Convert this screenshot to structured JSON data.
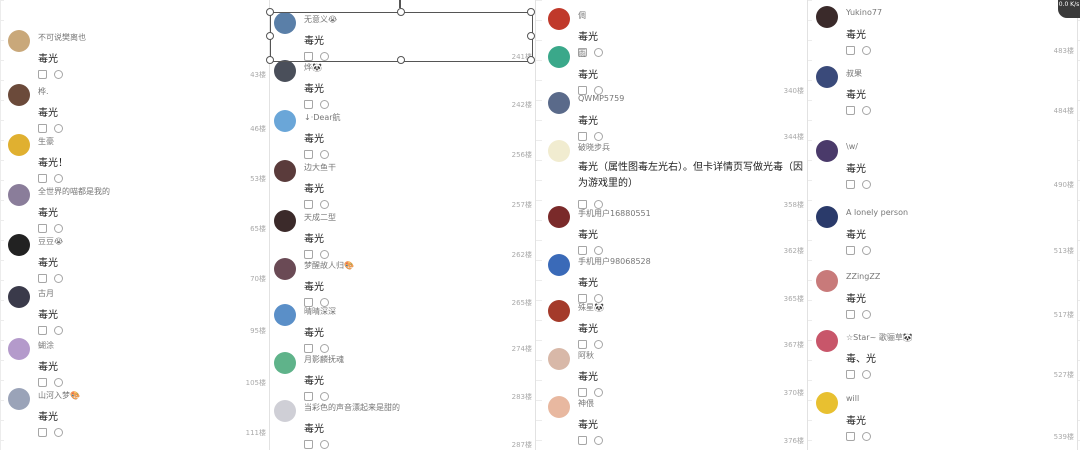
{
  "columns": [
    {
      "comments": [
        {
          "user": "不可说樊离也",
          "text": "毒光",
          "floor": "43楼",
          "avatar_color": "#c9a87a"
        },
        {
          "user": "桦.",
          "text": "毒光",
          "floor": "46楼",
          "avatar_color": "#6b4a3a"
        },
        {
          "user": "生豪",
          "text": "毒光！",
          "floor": "53楼",
          "avatar_color": "#e0b030"
        },
        {
          "user": "全世界的喵都是我的",
          "text": "毒光",
          "floor": "65楼",
          "avatar_color": "#8a7d9a"
        },
        {
          "user": "豆豆😭",
          "text": "毒光",
          "floor": "70楼",
          "avatar_color": "#222222"
        },
        {
          "user": "古月",
          "text": "毒光",
          "floor": "95楼",
          "avatar_color": "#3a3a4a"
        },
        {
          "user": "蝴涂",
          "text": "毒光",
          "floor": "105楼",
          "avatar_color": "#b49acb"
        },
        {
          "user": "山河入梦🎨",
          "text": "毒光",
          "floor": "111楼",
          "avatar_color": "#9aa3b8"
        }
      ]
    },
    {
      "comments": [
        {
          "user": "无意义😭",
          "text": "毒光",
          "floor": "241楼",
          "avatar_color": "#5a7fa8"
        },
        {
          "user": "烨🐼",
          "text": "毒光",
          "floor": "242楼",
          "avatar_color": "#4a4f5a"
        },
        {
          "user": "↓·Dear航",
          "text": "毒光",
          "floor": "256楼",
          "avatar_color": "#6aa6d8"
        },
        {
          "user": "边大鱼干",
          "text": "毒光",
          "floor": "257楼",
          "avatar_color": "#5a3b3b"
        },
        {
          "user": "天成二型",
          "text": "毒光",
          "floor": "262楼",
          "avatar_color": "#3b2a2a"
        },
        {
          "user": "梦醒故人归🎨",
          "text": "毒光",
          "floor": "265楼",
          "avatar_color": "#6a4a55"
        },
        {
          "user": "晴晴深深",
          "text": "毒光",
          "floor": "274楼",
          "avatar_color": "#5a8fc8"
        },
        {
          "user": "月影麟抚魂",
          "text": "毒光",
          "floor": "283楼",
          "avatar_color": "#5fb38a"
        },
        {
          "user": "当彩色的声音漂起来是甜的",
          "text": "毒光",
          "floor": "287楼",
          "avatar_color": "#cfcfd6"
        }
      ]
    },
    {
      "comments": [
        {
          "user": "倜",
          "text": "毒光",
          "floor": "",
          "avatar_color": "#c0392b"
        },
        {
          "user": "雨",
          "text": "毒光",
          "floor": "340楼",
          "avatar_color": "#3aa88a"
        },
        {
          "user": "QWMP5759",
          "text": "毒光",
          "floor": "344楼",
          "avatar_color": "#5a6a8a"
        },
        {
          "user": "破晓步兵",
          "text": "毒光（属性图毒左光右）。但卡详情页写做光毒（因为游戏里的）",
          "floor": "358楼",
          "avatar_color": "#f1ecd0"
        },
        {
          "user": "手机用户16880551",
          "text": "毒光",
          "floor": "362楼",
          "avatar_color": "#7a2a2a"
        },
        {
          "user": "手机用户98068528",
          "text": "毒光",
          "floor": "365楼",
          "avatar_color": "#3a6ab8"
        },
        {
          "user": "殊星🐼",
          "text": "毒光",
          "floor": "367楼",
          "avatar_color": "#a43a2a"
        },
        {
          "user": "阿秋",
          "text": "毒光",
          "floor": "370楼",
          "avatar_color": "#d8b8a8"
        },
        {
          "user": "神偎",
          "text": "毒光",
          "floor": "376楼",
          "avatar_color": "#e8b8a0"
        }
      ]
    },
    {
      "comments": [
        {
          "user": "Yukino77",
          "text": "毒光",
          "floor": "483楼",
          "avatar_color": "#3a2a2a"
        },
        {
          "user": "叔果",
          "text": "毒光",
          "floor": "484楼",
          "avatar_color": "#3a4a7a"
        },
        {
          "user": "\\w/",
          "text": "毒光",
          "floor": "490楼",
          "avatar_color": "#4a3a6a"
        },
        {
          "user": "A lonely person",
          "text": "毒光",
          "floor": "513楼",
          "avatar_color": "#2a3a6a"
        },
        {
          "user": "ZZingZZ",
          "text": "毒光",
          "floor": "517楼",
          "avatar_color": "#c87a7a"
        },
        {
          "user": "☆Star~ 歌骊草🐼",
          "text": "毒、光",
          "floor": "527楼",
          "avatar_color": "#c8566a"
        },
        {
          "user": "will",
          "text": "毒光",
          "floor": "539楼",
          "avatar_color": "#e8c030"
        }
      ]
    }
  ],
  "corner_badge": "0.0 K/s"
}
